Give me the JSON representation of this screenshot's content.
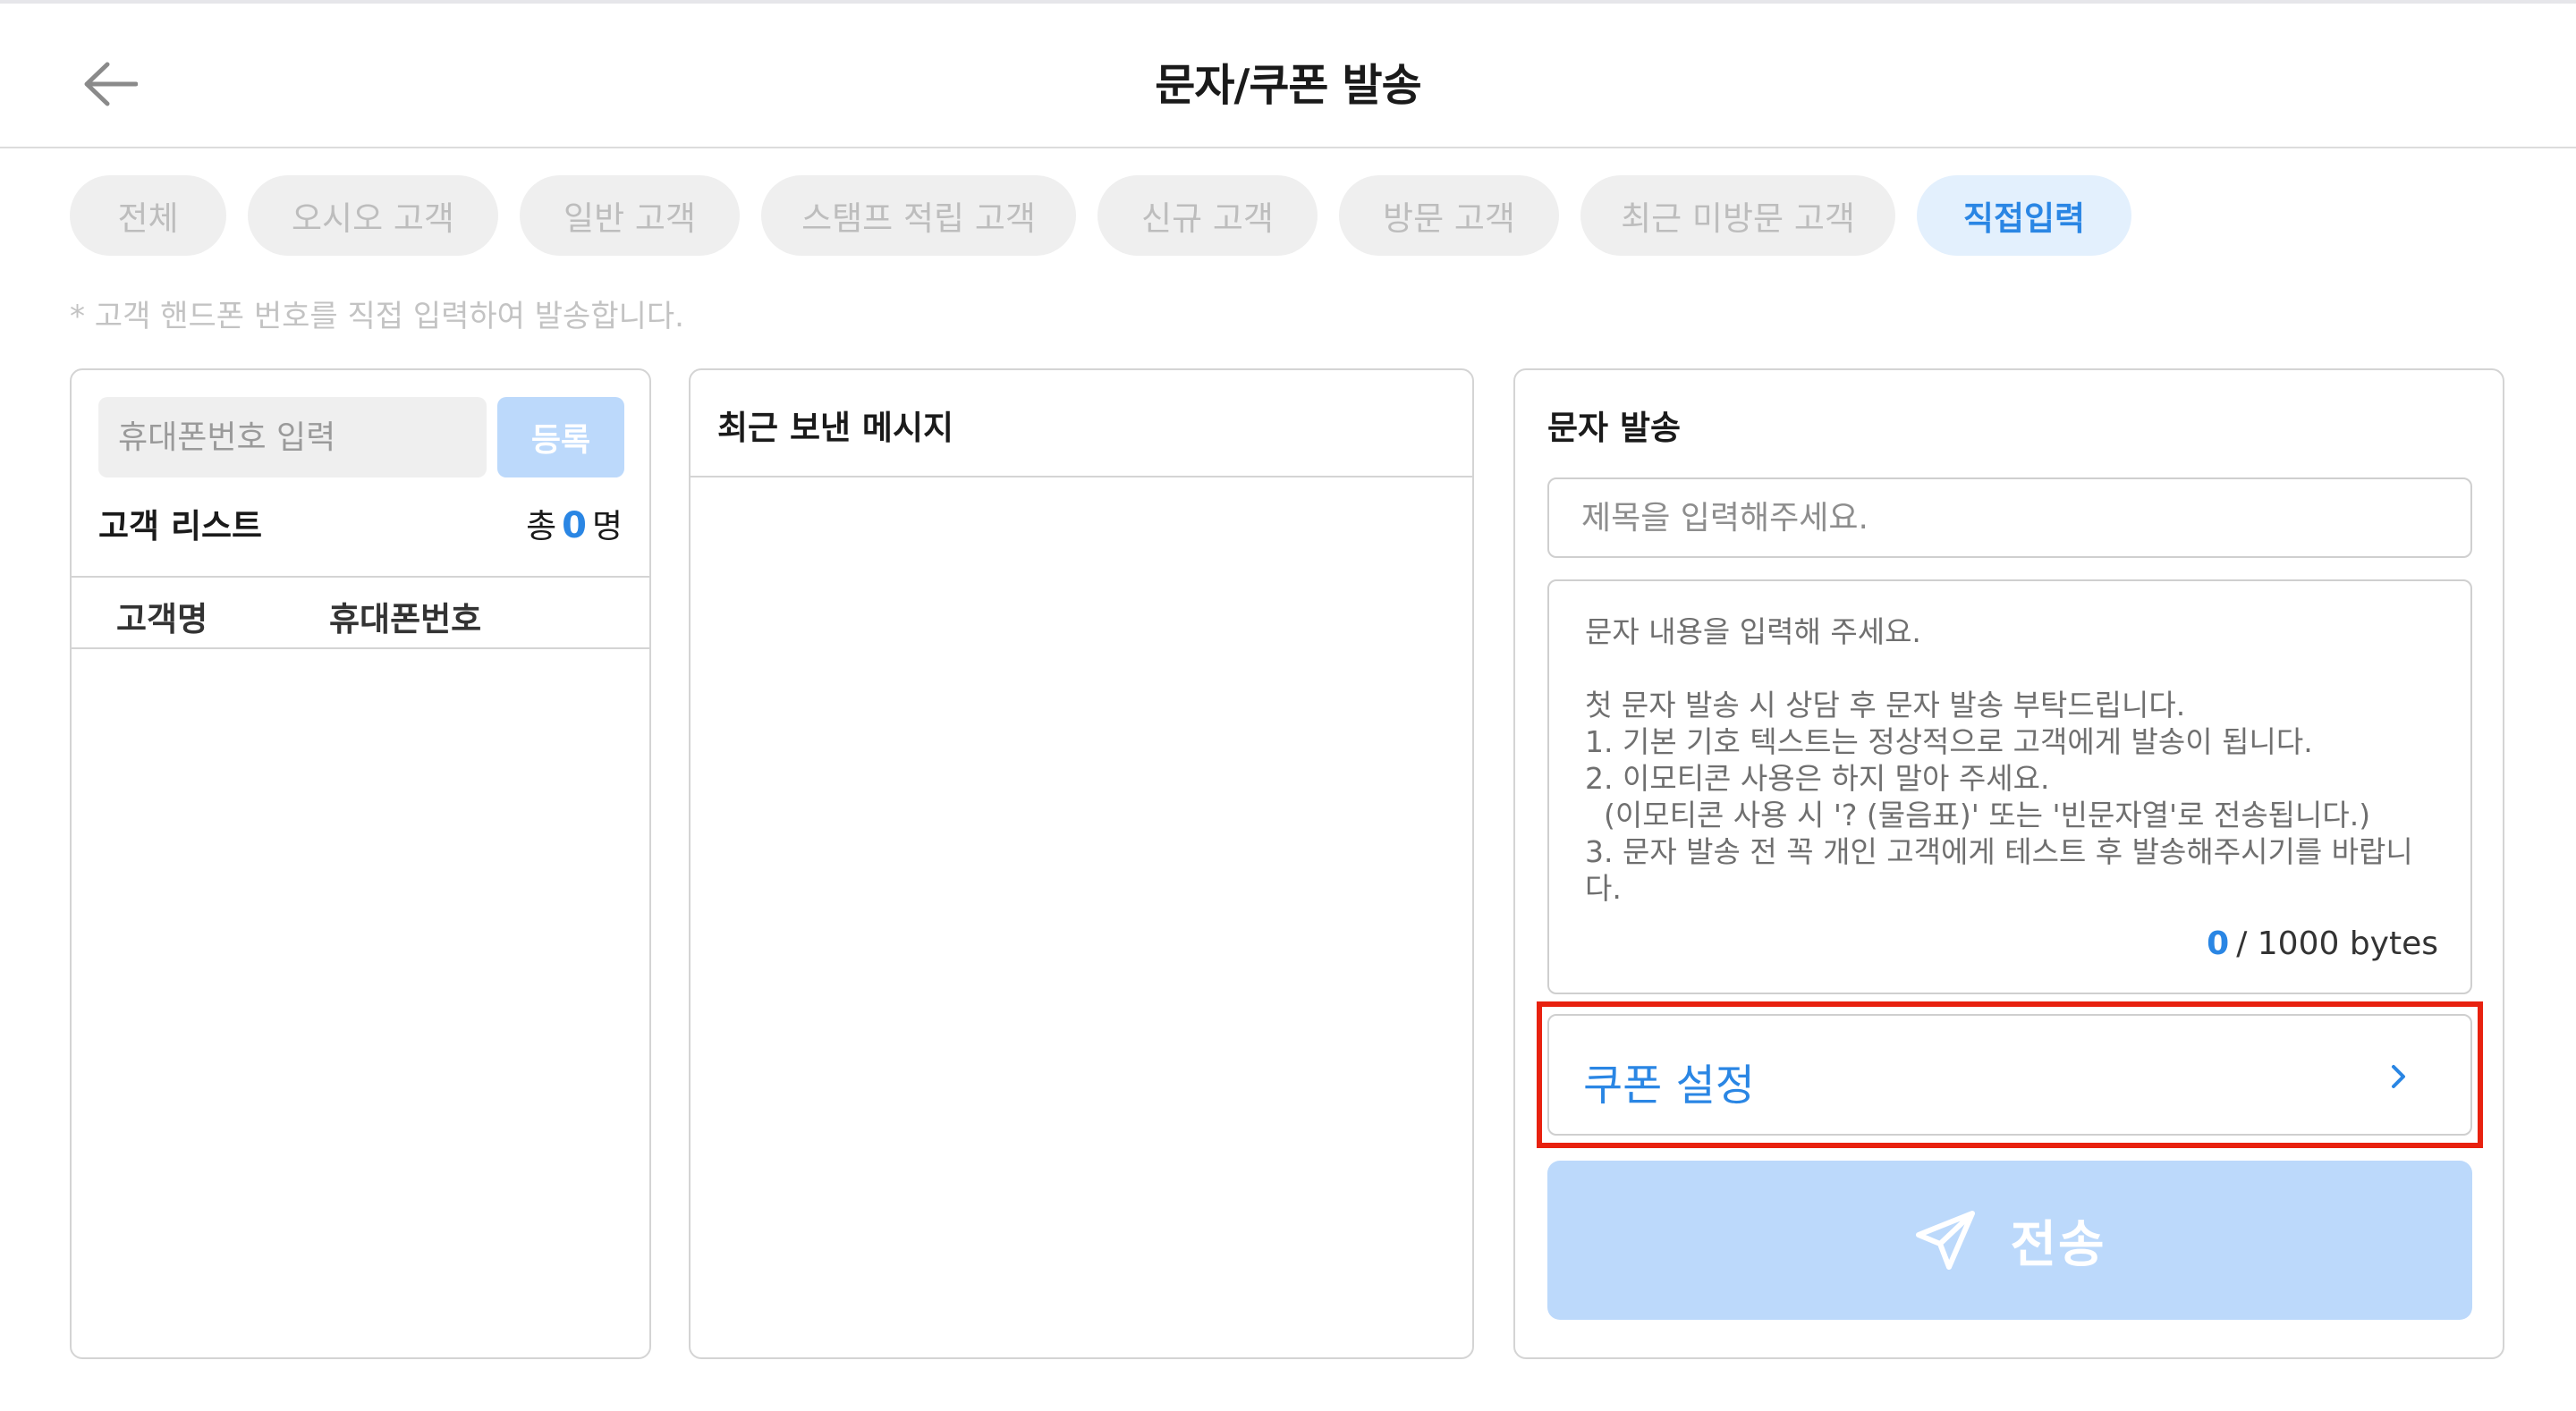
{
  "header": {
    "title": "문자/쿠폰 발송",
    "back_icon": "arrow-left-icon"
  },
  "tabs": [
    {
      "label": "전체",
      "active": false
    },
    {
      "label": "오시오 고객",
      "active": false
    },
    {
      "label": "일반 고객",
      "active": false
    },
    {
      "label": "스탬프 적립 고객",
      "active": false
    },
    {
      "label": "신규 고객",
      "active": false
    },
    {
      "label": "방문 고객",
      "active": false
    },
    {
      "label": "최근 미방문 고객",
      "active": false
    },
    {
      "label": "직접입력",
      "active": true
    }
  ],
  "note": "* 고객 핸드폰 번호를 직접 입력하여 발송합니다.",
  "left_panel": {
    "phone_placeholder": "휴대폰번호 입력",
    "register_label": "등록",
    "list_title": "고객 리스트",
    "count_prefix": "총",
    "count_value": "0",
    "count_suffix": "명",
    "columns": [
      "고객명",
      "휴대폰번호"
    ],
    "rows": []
  },
  "middle_panel": {
    "title": "최근 보낸 메시지",
    "messages": []
  },
  "right_panel": {
    "title": "문자 발송",
    "subject_placeholder": "제목을 입력해주세요.",
    "message_lines": [
      "문자 내용을 입력해 주세요.",
      "",
      "첫 문자 발송 시 상담 후 문자 발송 부탁드립니다.",
      "1. 기본 기호 텍스트는 정상적으로 고객에게 발송이 됩니다.",
      "2. 이모티콘 사용은 하지 말아 주세요.",
      "  (이모티콘 사용 시 '? (물음표)' 또는 '빈문자열'로 전송됩니다.)",
      "3. 문자 발송 전 꼭 개인 고객에게 테스트 후 발송해주시기를 바랍니",
      "다."
    ],
    "byte_count": "0",
    "byte_total": "/ 1000 bytes",
    "coupon_label": "쿠폰 설정",
    "send_label": "전송"
  },
  "colors": {
    "accent": "#2a86e4",
    "accent_light": "#bcd9fb",
    "tab_active_bg": "#e3f0fd",
    "highlight": "#e8210f"
  }
}
